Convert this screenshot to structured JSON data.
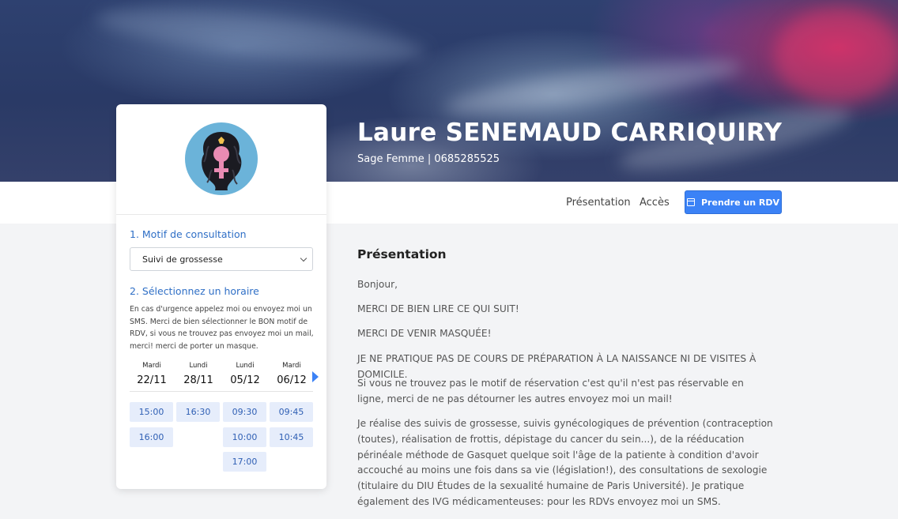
{
  "profile": {
    "name": "Laure SENEMAUD CARRIQUIRY",
    "subtitle": "Sage Femme | 0685285525"
  },
  "nav": {
    "presentation": "Présentation",
    "acces": "Accès",
    "rdv_button": "Prendre un RDV"
  },
  "booking": {
    "step1_title": "1. Motif de consultation",
    "motif_selected": "Suivi de grossesse",
    "step2_title": "2. Sélectionnez un horaire",
    "notice": "En cas d'urgence appelez moi ou envoyez moi un SMS. Merci de bien sélectionner le BON motif de RDV, si vous ne trouvez pas envoyez moi un mail, merci! merci de porter un masque.",
    "days": [
      {
        "name": "Mardi",
        "date": "22/11",
        "slots": [
          "15:00",
          "16:00"
        ]
      },
      {
        "name": "Lundi",
        "date": "28/11",
        "slots": [
          "16:30"
        ]
      },
      {
        "name": "Lundi",
        "date": "05/12",
        "slots": [
          "09:30",
          "10:00",
          "17:00"
        ]
      },
      {
        "name": "Mardi",
        "date": "06/12",
        "slots": [
          "09:45",
          "10:45"
        ]
      }
    ]
  },
  "content": {
    "title": "Présentation",
    "paragraphs": [
      "Bonjour,",
      "MERCI DE BIEN LIRE CE QUI SUIT!",
      "MERCI DE VENIR MASQUÉE!",
      "JE NE PRATIQUE PAS DE COURS DE PRÉPARATION À LA NAISSANCE NI DE VISITES À DOMICILE.",
      "Si vous ne trouvez pas le motif de réservation c'est qu'il n'est pas réservable en ligne, merci de ne pas détourner les autres envoyez moi un mail!",
      "Je réalise des suivis de grossesse, suivis gynécologiques de prévention (contraception (toutes), réalisation de frottis, dépistage du cancer du sein...), de la rééducation périnéale méthode de Gasquet quelque soit l'âge de la patiente à condition d'avoir accouché au moins une fois dans sa vie (législation!), des consultations de sexologie (titulaire du DIU Études de la sexualité humaine de Paris Université). Je pratique également des IVG médicamenteuses: pour les RDVs envoyez moi un SMS."
    ]
  },
  "colors": {
    "accent": "#3b82f6",
    "link_blue": "#2f6fc6",
    "slot_bg": "#e6edfb"
  }
}
